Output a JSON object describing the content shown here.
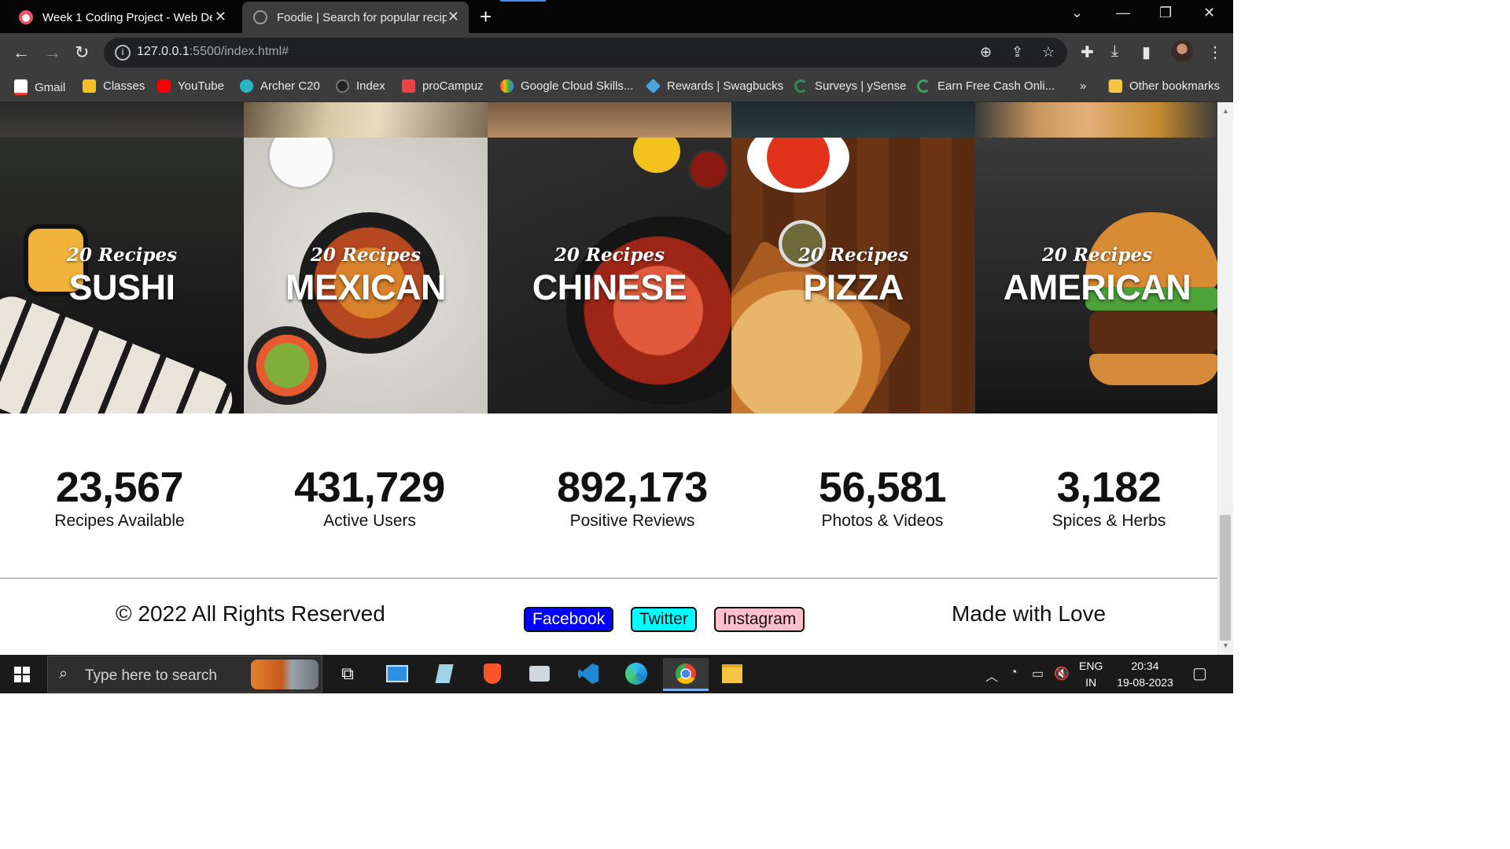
{
  "browser": {
    "tabs": [
      {
        "title": "Week 1 Coding Project - Web De",
        "active": false,
        "favicon_color": "#e8556d"
      },
      {
        "title": "Foodie | Search for popular recip",
        "active": true,
        "favicon_color": "#8a8a8a"
      }
    ],
    "new_tab_icon": "plus-icon",
    "url": {
      "host": "127.0.0.1",
      "rest": ":5500/index.html#"
    },
    "bookmarks": [
      {
        "label": "Gmail",
        "color": "#ea4335"
      },
      {
        "label": "Classes",
        "color": "#f6c026"
      },
      {
        "label": "YouTube",
        "color": "#ff0000"
      },
      {
        "label": "Archer C20",
        "color": "#27b6c8"
      },
      {
        "label": "Index",
        "color": "#222222"
      },
      {
        "label": "proCampuz",
        "color": "#ef4242"
      },
      {
        "label": "Google Cloud Skills...",
        "color": "#4285f4"
      },
      {
        "label": "Rewards | Swagbucks",
        "color": "#4aa3df"
      },
      {
        "label": "Surveys | ySense",
        "color": "#2e8b57"
      },
      {
        "label": "Earn Free Cash Onli...",
        "color": "#3aa35b"
      }
    ],
    "more_bookmarks": "»",
    "other_bookmarks": "Other bookmarks"
  },
  "page": {
    "cuisines": [
      {
        "recipes": "20 Recipes",
        "name": "SUSHI"
      },
      {
        "recipes": "20 Recipes",
        "name": "MEXICAN"
      },
      {
        "recipes": "20 Recipes",
        "name": "CHINESE"
      },
      {
        "recipes": "20 Recipes",
        "name": "PIZZA"
      },
      {
        "recipes": "20 Recipes",
        "name": "AMERICAN"
      }
    ],
    "stats": [
      {
        "value": "23,567",
        "label": "Recipes Available"
      },
      {
        "value": "431,729",
        "label": "Active Users"
      },
      {
        "value": "892,173",
        "label": "Positive Reviews"
      },
      {
        "value": "56,581",
        "label": "Photos & Videos"
      },
      {
        "value": "3,182",
        "label": "Spices & Herbs"
      }
    ],
    "footer": {
      "copyright": "© 2022 All Rights Reserved",
      "social": [
        {
          "label": "Facebook",
          "bg": "#0000ff",
          "fg": "#ffffff"
        },
        {
          "label": "Twitter",
          "bg": "#00ffff",
          "fg": "#111111"
        },
        {
          "label": "Instagram",
          "bg": "#ffc0cb",
          "fg": "#111111"
        }
      ],
      "made_with": "Made with Love"
    }
  },
  "taskbar": {
    "search_placeholder": "Type here to search",
    "language": [
      "ENG",
      "IN"
    ],
    "time": "20:34",
    "date": "19-08-2023"
  }
}
